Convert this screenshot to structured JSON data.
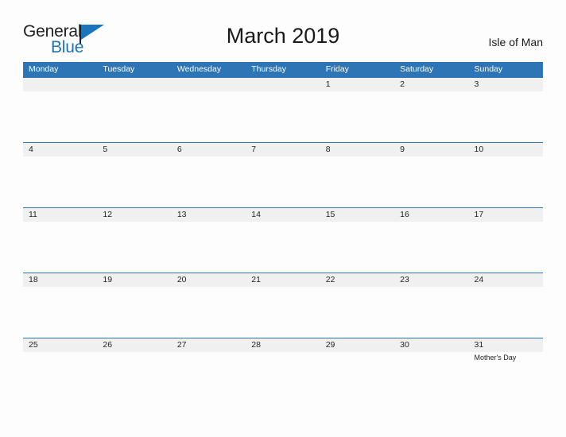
{
  "brand": {
    "name_part1": "General",
    "name_part2": "Blue",
    "flag_icon": "blue-flag-triangle-icon"
  },
  "header": {
    "title": "March 2019",
    "region": "Isle of Man"
  },
  "colors": {
    "header_blue": "#2e75b6",
    "row_divider_blue": "#2e75b6",
    "day_band_gray": "#f0f0f0",
    "text_dark": "#231f20",
    "brand_blue": "#2072b8",
    "page_background": "#fdfdfd"
  },
  "calendar": {
    "weekdays": [
      "Monday",
      "Tuesday",
      "Wednesday",
      "Thursday",
      "Friday",
      "Saturday",
      "Sunday"
    ],
    "weeks": [
      [
        {
          "day": "",
          "event": ""
        },
        {
          "day": "",
          "event": ""
        },
        {
          "day": "",
          "event": ""
        },
        {
          "day": "",
          "event": ""
        },
        {
          "day": "1",
          "event": ""
        },
        {
          "day": "2",
          "event": ""
        },
        {
          "day": "3",
          "event": ""
        }
      ],
      [
        {
          "day": "4",
          "event": ""
        },
        {
          "day": "5",
          "event": ""
        },
        {
          "day": "6",
          "event": ""
        },
        {
          "day": "7",
          "event": ""
        },
        {
          "day": "8",
          "event": ""
        },
        {
          "day": "9",
          "event": ""
        },
        {
          "day": "10",
          "event": ""
        }
      ],
      [
        {
          "day": "11",
          "event": ""
        },
        {
          "day": "12",
          "event": ""
        },
        {
          "day": "13",
          "event": ""
        },
        {
          "day": "14",
          "event": ""
        },
        {
          "day": "15",
          "event": ""
        },
        {
          "day": "16",
          "event": ""
        },
        {
          "day": "17",
          "event": ""
        }
      ],
      [
        {
          "day": "18",
          "event": ""
        },
        {
          "day": "19",
          "event": ""
        },
        {
          "day": "20",
          "event": ""
        },
        {
          "day": "21",
          "event": ""
        },
        {
          "day": "22",
          "event": ""
        },
        {
          "day": "23",
          "event": ""
        },
        {
          "day": "24",
          "event": ""
        }
      ],
      [
        {
          "day": "25",
          "event": ""
        },
        {
          "day": "26",
          "event": ""
        },
        {
          "day": "27",
          "event": ""
        },
        {
          "day": "28",
          "event": ""
        },
        {
          "day": "29",
          "event": ""
        },
        {
          "day": "30",
          "event": ""
        },
        {
          "day": "31",
          "event": "Mother's Day"
        }
      ]
    ]
  }
}
